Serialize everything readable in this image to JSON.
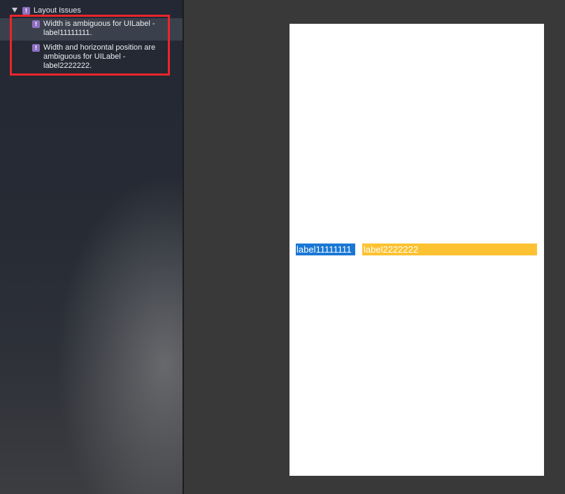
{
  "navigator": {
    "group": {
      "label": "Layout Issues",
      "badge": "!"
    },
    "issues": [
      {
        "badge": "!",
        "line1": "Width is ambiguous for UILabel -",
        "line2": "label11111111.",
        "selected": true
      },
      {
        "badge": "!",
        "line1": "Width and horizontal position are",
        "line2": "ambiguous for UILabel -",
        "line3": "label2222222.",
        "selected": false
      }
    ]
  },
  "canvas": {
    "labels": [
      {
        "text": "label11111111",
        "color": "#1a78d5"
      },
      {
        "text": "label2222222",
        "color": "#fcc231"
      }
    ]
  },
  "colors": {
    "highlight_border": "#e8262b",
    "issue_badge": "#8e6fbf",
    "canvas_background": "#393939",
    "device_background": "#ffffff"
  }
}
